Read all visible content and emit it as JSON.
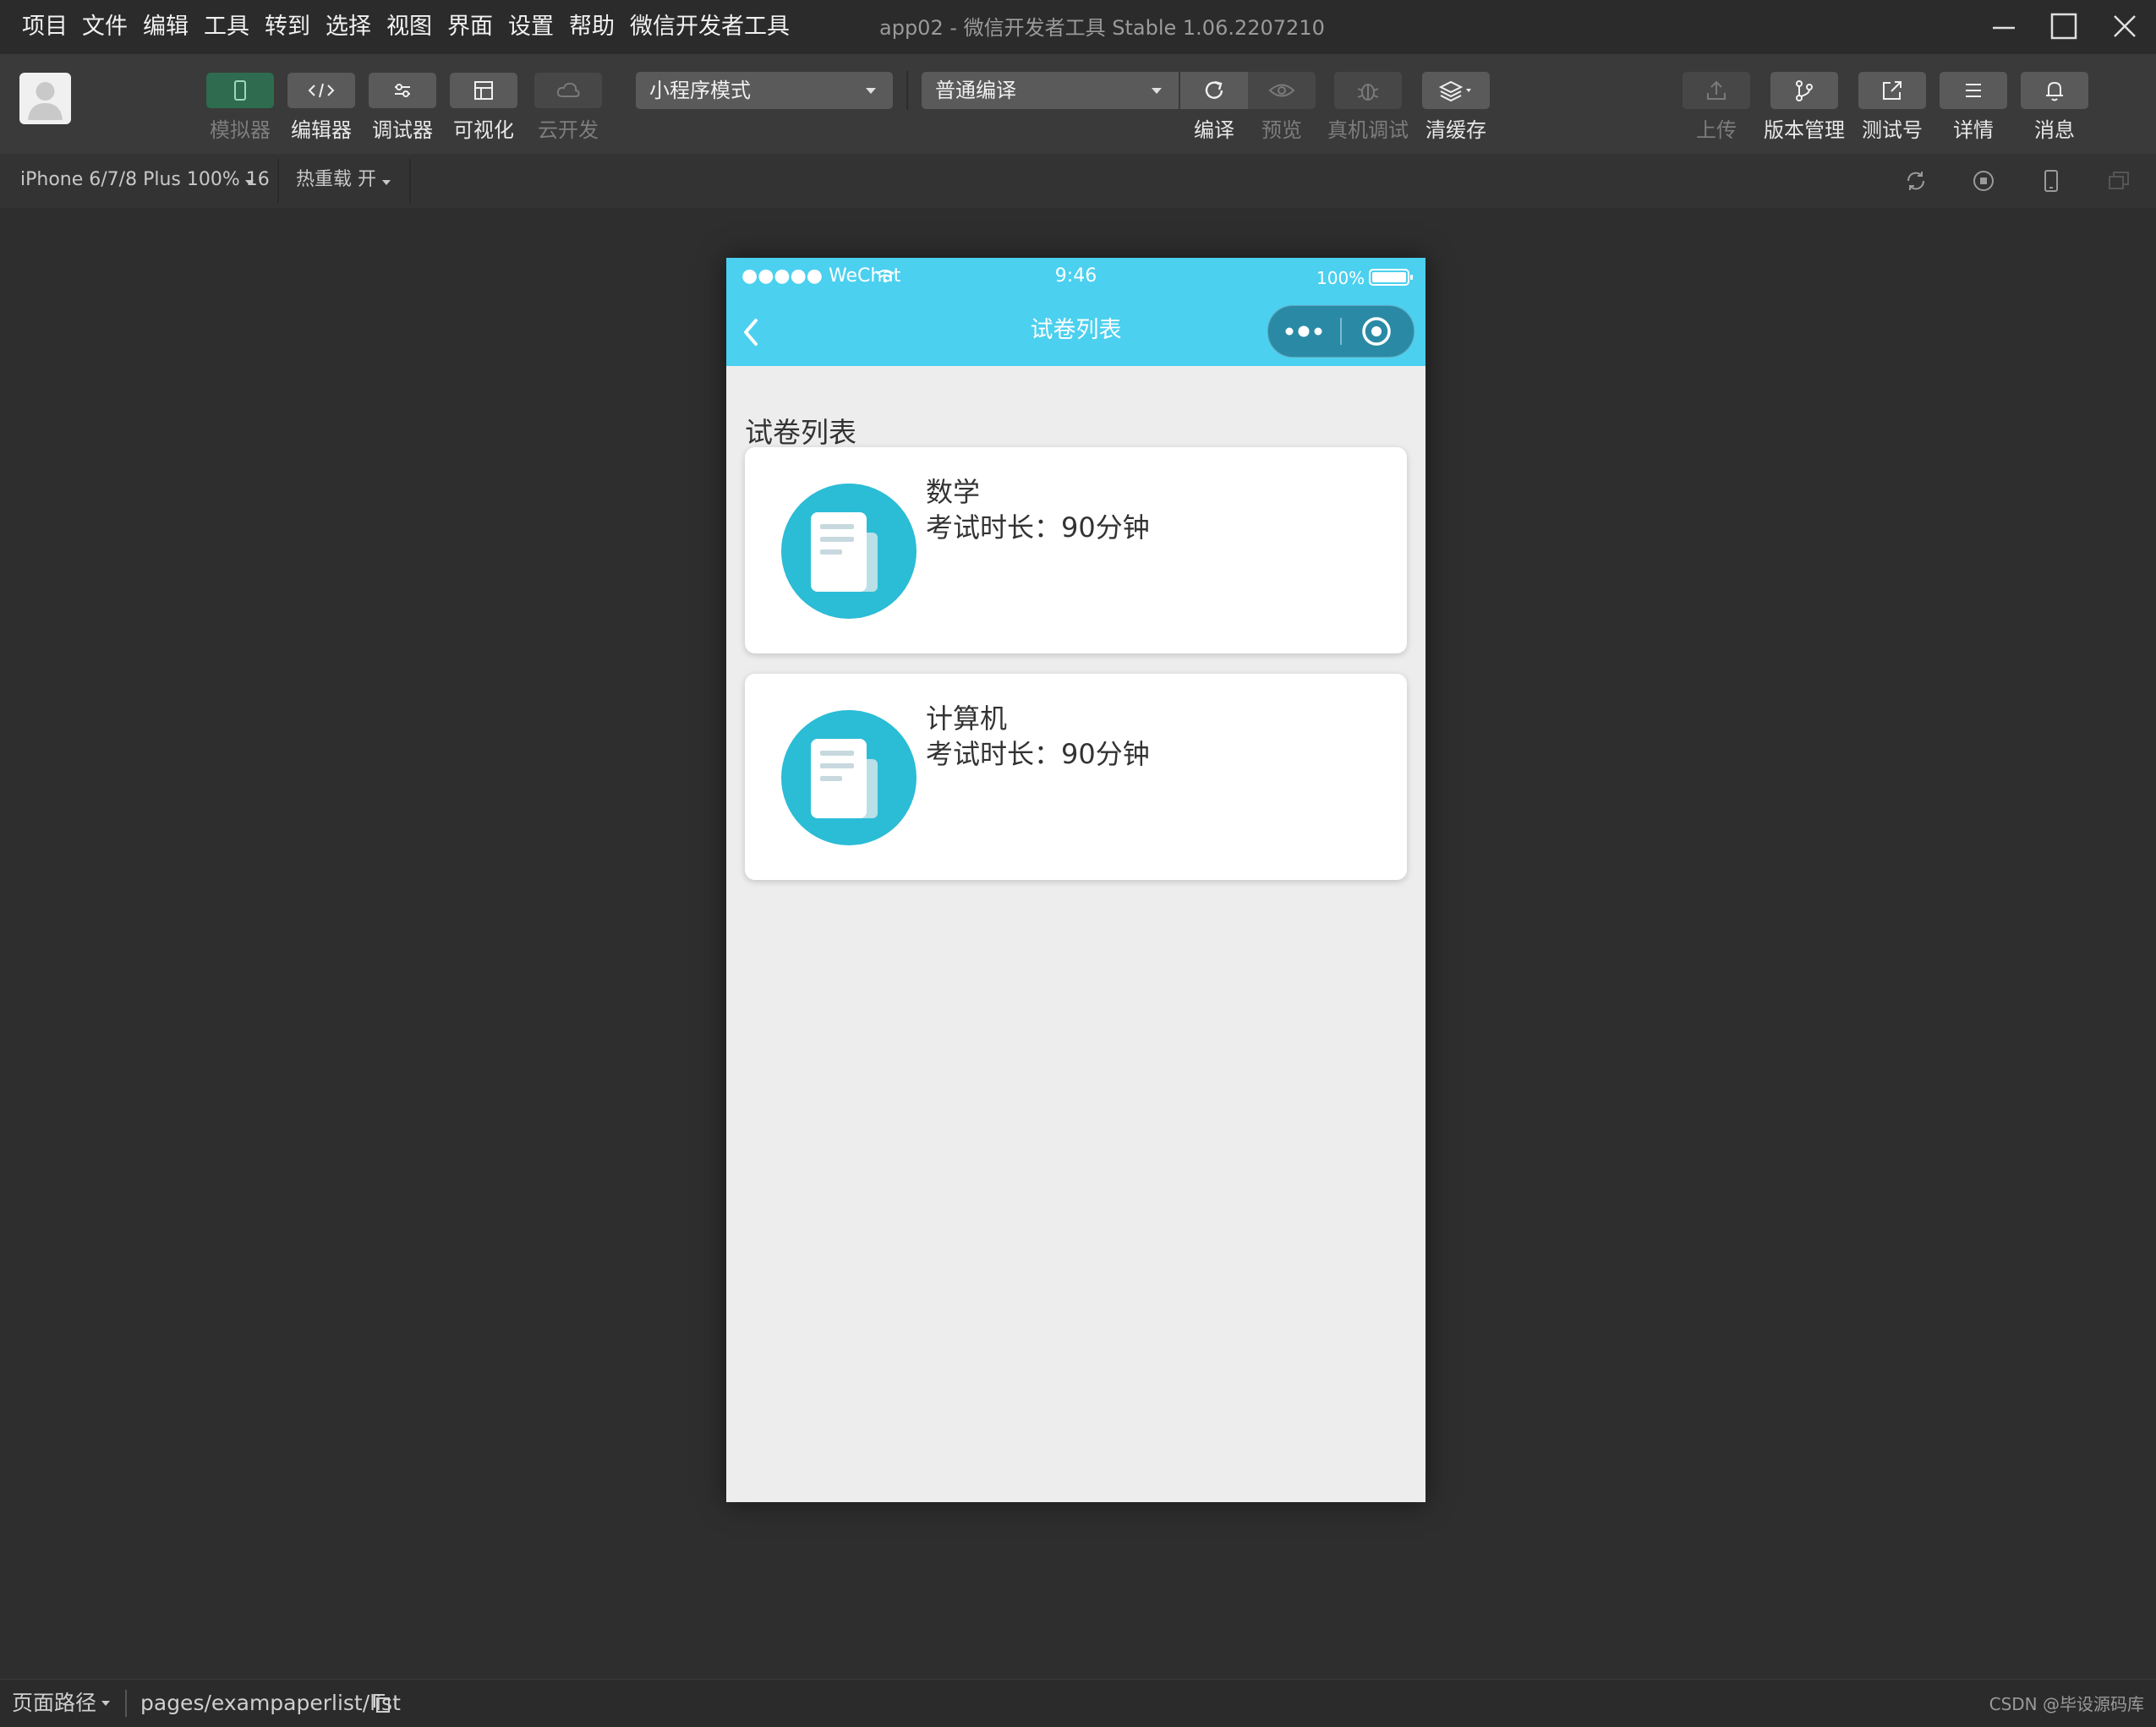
{
  "menu": {
    "items": [
      "项目",
      "文件",
      "编辑",
      "工具",
      "转到",
      "选择",
      "视图",
      "界面",
      "设置",
      "帮助",
      "微信开发者工具"
    ],
    "window_title": "app02 - 微信开发者工具 Stable 1.06.2207210"
  },
  "toolbar": {
    "left_buttons": [
      {
        "label": "模拟器",
        "icon": "phone-icon",
        "state": "active"
      },
      {
        "label": "编辑器",
        "icon": "code-icon",
        "state": "normal"
      },
      {
        "label": "调试器",
        "icon": "sliders-icon",
        "state": "normal"
      },
      {
        "label": "可视化",
        "icon": "layout-icon",
        "state": "normal"
      },
      {
        "label": "云开发",
        "icon": "cloud-icon",
        "state": "disabled"
      }
    ],
    "mode_select": "小程序模式",
    "compile_select": "普通编译",
    "compile_buttons": [
      {
        "label": "编译",
        "icon": "refresh-icon"
      },
      {
        "label": "预览",
        "icon": "eye-icon"
      },
      {
        "label": "真机调试",
        "icon": "bug-icon"
      },
      {
        "label": "清缓存",
        "icon": "layers-icon"
      }
    ],
    "right_buttons": [
      {
        "label": "上传",
        "icon": "upload-icon"
      },
      {
        "label": "版本管理",
        "icon": "branch-icon"
      },
      {
        "label": "测试号",
        "icon": "external-link-icon"
      },
      {
        "label": "详情",
        "icon": "menu-icon"
      },
      {
        "label": "消息",
        "icon": "bell-icon"
      }
    ]
  },
  "subbar": {
    "device": "iPhone 6/7/8 Plus 100% 16",
    "hot_reload": "热重载 开"
  },
  "phone": {
    "status": {
      "carrier": "●●●●● WeChat",
      "time": "9:46",
      "battery": "100%"
    },
    "nav_title": "试卷列表",
    "section_title": "试卷列表",
    "cards": [
      {
        "name": "数学",
        "duration": "考试时长：90分钟"
      },
      {
        "name": "计算机",
        "duration": "考试时长：90分钟"
      }
    ]
  },
  "bottombar": {
    "path_label": "页面路径",
    "path": "pages/exampaperlist/list",
    "watermark": "CSDN @毕设源码库"
  },
  "colors": {
    "accent": "#4bd0ef",
    "icon_circle": "#2bbcd6",
    "background": "#2e2e2e"
  }
}
